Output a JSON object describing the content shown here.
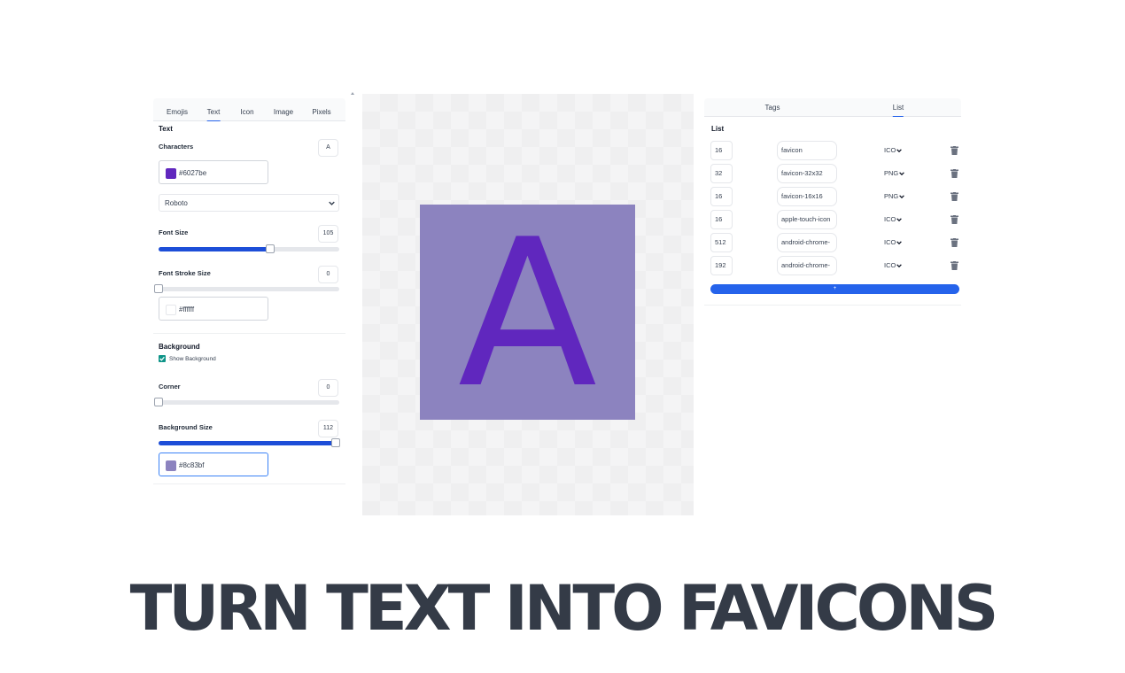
{
  "left_panel": {
    "tabs": [
      "Emojis",
      "Text",
      "Icon",
      "Image",
      "Pixels"
    ],
    "active_tab": "Text",
    "text_section": {
      "title": "Text",
      "characters_label": "Characters",
      "characters_value": "A",
      "text_color": "#6027be",
      "font_family": "Roboto",
      "font_size_label": "Font Size",
      "font_size_value": "105",
      "font_size_slider_fraction": 0.62,
      "stroke_label": "Font Stroke Size",
      "stroke_value": "0",
      "stroke_slider_fraction": 0,
      "stroke_color": "#ffffff",
      "stroke_color_display": "#ffffff"
    },
    "background_section": {
      "title": "Background",
      "show_background_label": "Show Background",
      "show_background_checked": true,
      "corner_label": "Corner",
      "corner_value": "0",
      "corner_slider_fraction": 0,
      "bg_size_label": "Background Size",
      "bg_size_value": "112",
      "bg_size_slider_fraction": 0.98,
      "bg_color": "#8c83bf"
    }
  },
  "preview": {
    "character": "A",
    "text_color": "#6027be",
    "background_color": "#8c83bf"
  },
  "right_panel": {
    "tabs": [
      "Tags",
      "List"
    ],
    "active_tab": "List",
    "list_title": "List",
    "rows": [
      {
        "size": "16",
        "name": "favicon",
        "format": "ICO"
      },
      {
        "size": "32",
        "name": "favicon-32x32",
        "format": "PNG"
      },
      {
        "size": "16",
        "name": "favicon-16x16",
        "format": "PNG"
      },
      {
        "size": "16",
        "name": "apple-touch-icon",
        "format": "ICO"
      },
      {
        "size": "512",
        "name": "android-chrome-",
        "format": "ICO"
      },
      {
        "size": "192",
        "name": "android-chrome-",
        "format": "ICO"
      }
    ],
    "add_label": "+"
  },
  "headline": "TURN TEXT INTO FAVICONS",
  "colors": {
    "accent": "#2563eb",
    "checkbox": "#0d9488",
    "headline": "#343b47"
  },
  "icons": [
    "chevron-down-icon",
    "trash-icon",
    "checkbox-checked-icon"
  ]
}
